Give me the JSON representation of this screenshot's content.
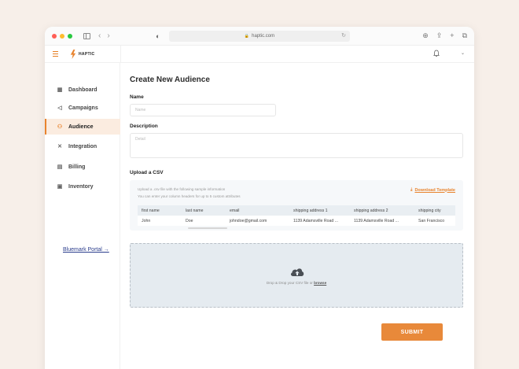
{
  "browser": {
    "url": "haptic.com",
    "colors": {
      "close": "#ff5f57",
      "minimize": "#febc2e",
      "maximize": "#28c840"
    }
  },
  "brand": {
    "name": "HAPTIC",
    "accent": "#e8842f"
  },
  "sidebar": {
    "items": [
      {
        "label": "Dashboard",
        "icon": "grid-icon",
        "glyph": "▦",
        "active": false
      },
      {
        "label": "Campaigns",
        "icon": "megaphone-icon",
        "glyph": "📢",
        "active": false
      },
      {
        "label": "Audience",
        "icon": "users-icon",
        "glyph": "👥",
        "active": true
      },
      {
        "label": "Integration",
        "icon": "tools-icon",
        "glyph": "✂",
        "active": false
      },
      {
        "label": "Billing",
        "icon": "document-icon",
        "glyph": "▤",
        "active": false
      },
      {
        "label": "Inventory",
        "icon": "box-icon",
        "glyph": "▣",
        "active": false
      }
    ],
    "portal_link": "Bluemark Portal →"
  },
  "main": {
    "title": "Create New Audience",
    "name_label": "Name",
    "name_placeholder": "Name",
    "description_label": "Description",
    "description_placeholder": "Detail",
    "upload_label": "Upload a CSV",
    "csv_help_1": "Upload a .csv file with the following sample information",
    "csv_help_2": "You can enter your column headers for up to 5 custom attributes",
    "download_label": "Download Template",
    "table": {
      "columns": [
        "first name",
        "last name",
        "email",
        "shipping address 1",
        "shipping address 2",
        "shipping city"
      ],
      "rows": [
        [
          "John",
          "Doe",
          "johndoe@gmail.com",
          "1139 Adamsville Road ...",
          "1139 Adamsville Road ...",
          "San Francisco"
        ]
      ]
    },
    "drop_text": "Drop & Drop your CSV file or",
    "drop_link": "browse",
    "submit_label": "SUBMIT"
  }
}
